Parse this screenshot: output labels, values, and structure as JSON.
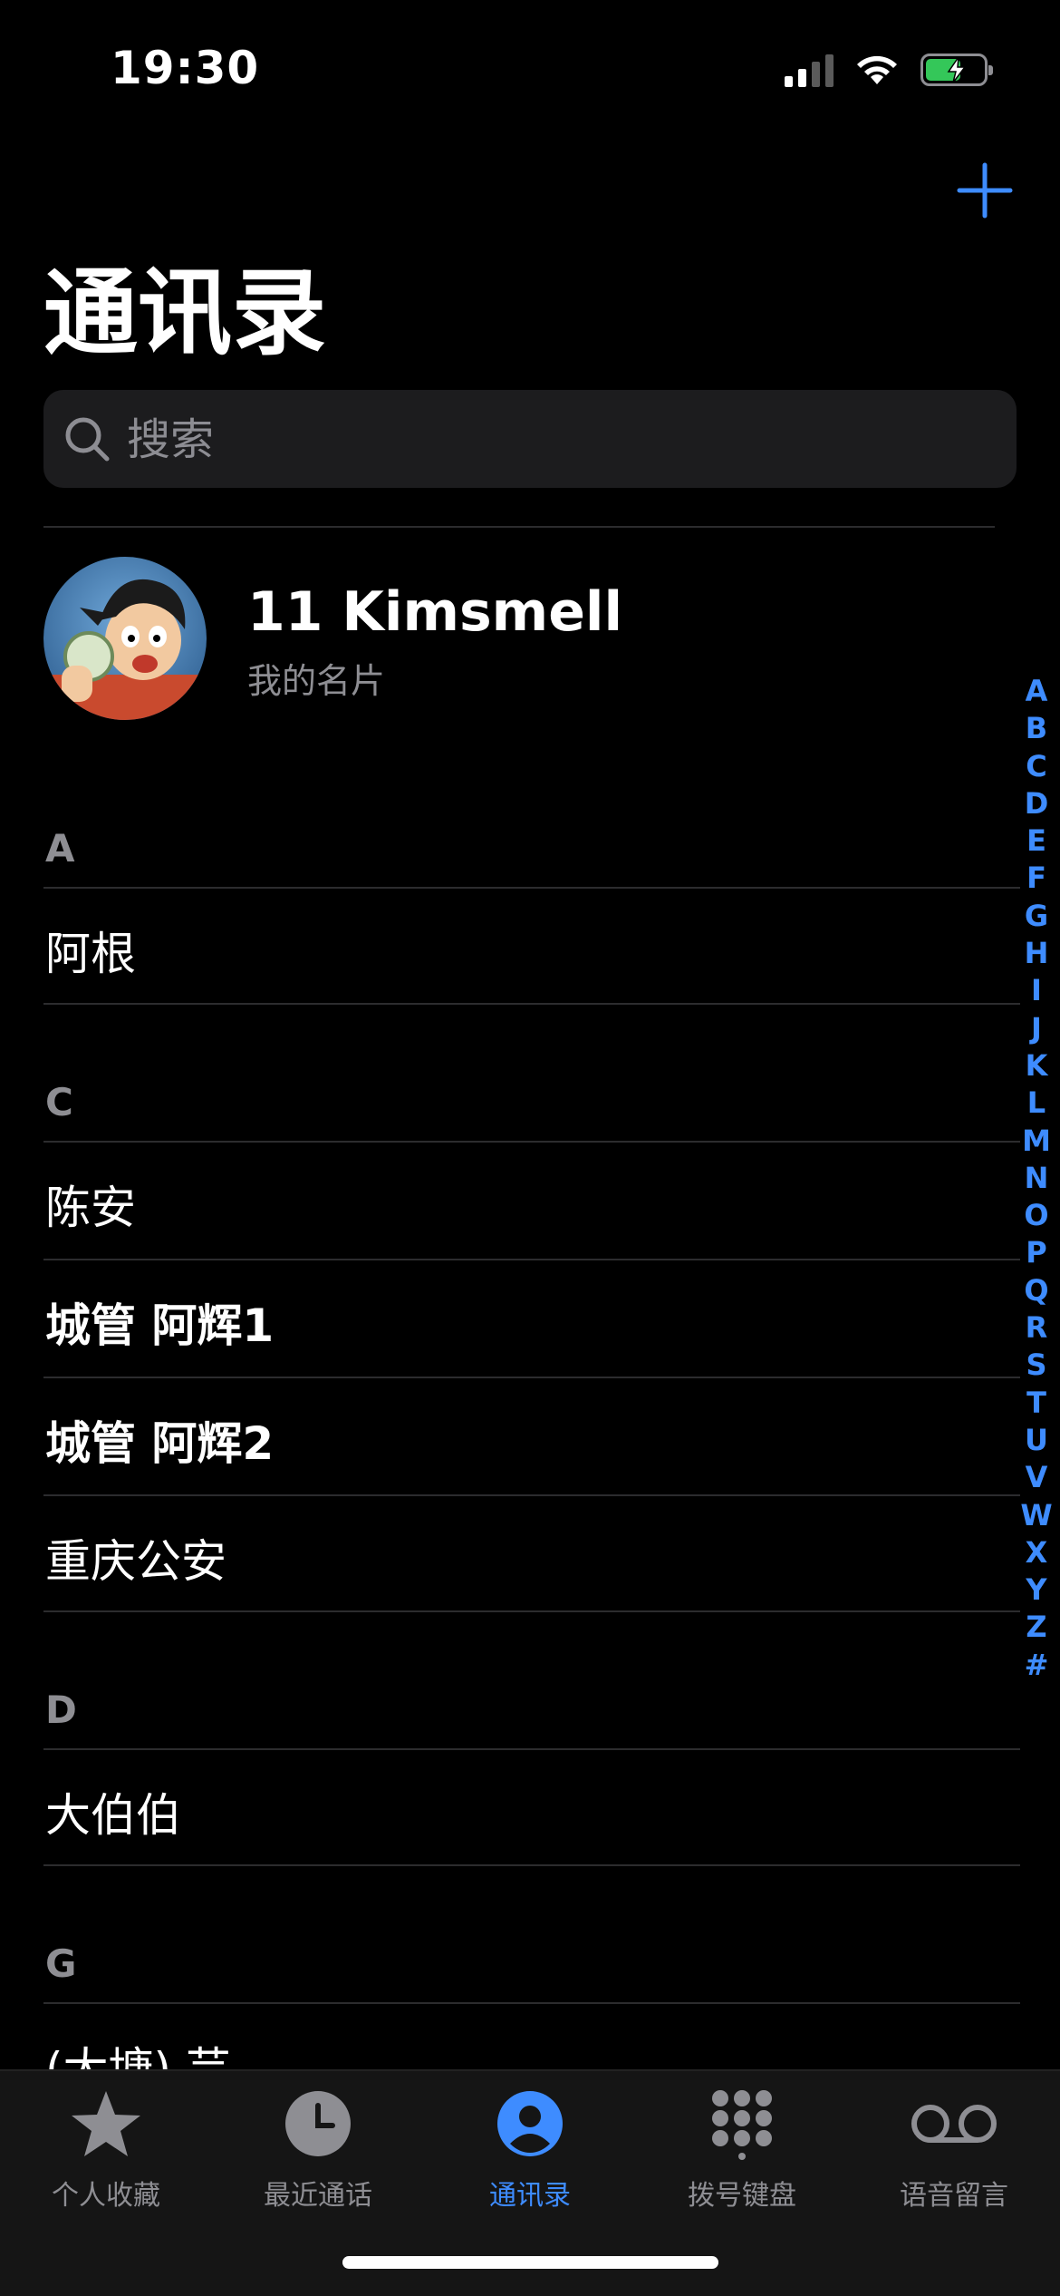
{
  "status": {
    "time": "19:30"
  },
  "header": {
    "title": "通讯录"
  },
  "search": {
    "placeholder": "搜索"
  },
  "my_card": {
    "name": "11 Kimsmell",
    "subtitle": "我的名片"
  },
  "sections": [
    {
      "letter": "A",
      "contacts": [
        {
          "name": "阿根",
          "bold": false
        }
      ]
    },
    {
      "letter": "C",
      "contacts": [
        {
          "name": "陈安",
          "bold": false
        },
        {
          "name": "城管 阿辉1",
          "bold": true
        },
        {
          "name": "城管 阿辉2",
          "bold": true
        },
        {
          "name": "重庆公安",
          "bold": false
        }
      ]
    },
    {
      "letter": "D",
      "contacts": [
        {
          "name": "大伯伯",
          "bold": false
        }
      ]
    },
    {
      "letter": "G",
      "contacts": [
        {
          "name": "(大塘) 芸",
          "bold": false
        }
      ]
    }
  ],
  "index_letters": [
    "A",
    "B",
    "C",
    "D",
    "E",
    "F",
    "G",
    "H",
    "I",
    "J",
    "K",
    "L",
    "M",
    "N",
    "O",
    "P",
    "Q",
    "R",
    "S",
    "T",
    "U",
    "V",
    "W",
    "X",
    "Y",
    "Z",
    "#"
  ],
  "tabs": [
    {
      "label": "个人收藏",
      "icon": "star-icon",
      "active": false
    },
    {
      "label": "最近通话",
      "icon": "clock-icon",
      "active": false
    },
    {
      "label": "通讯录",
      "icon": "person-circle-icon",
      "active": true
    },
    {
      "label": "拨号键盘",
      "icon": "keypad-icon",
      "active": false
    },
    {
      "label": "语音留言",
      "icon": "voicemail-icon",
      "active": false
    }
  ],
  "colors": {
    "accent": "#3e8cff",
    "background": "#000000",
    "battery": "#34c759"
  }
}
